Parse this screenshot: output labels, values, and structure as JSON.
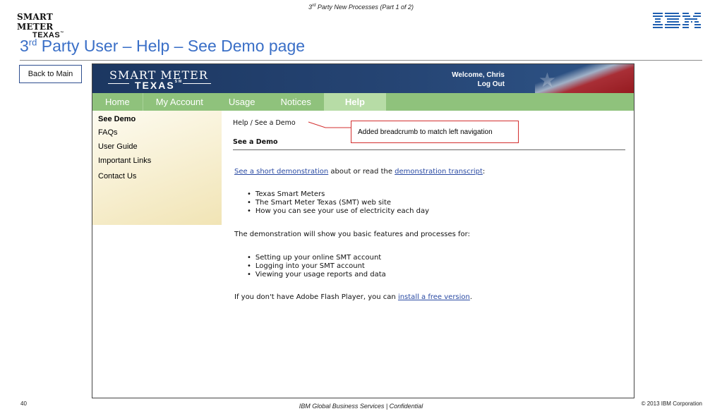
{
  "slide": {
    "header_note_sup": "rd",
    "header_note_rest": " Party New Processes (Part 1 of 2)",
    "header_note_pre": "3",
    "title_pre": "3",
    "title_sup": "rd",
    "title_rest": " Party User – Help – See Demo page",
    "logo_line1": "SMART METER",
    "logo_line2": "TEXAS",
    "logo_tm": "™",
    "ibm": "IBM",
    "back_button": "Back to Main",
    "page_number": "40",
    "footer_center": "IBM Global Business Services |  Confidential",
    "footer_right": "© 2013 IBM Corporation"
  },
  "site": {
    "logo_line1": "SMART METER",
    "logo_line2": "TEXAS",
    "logo_tm": "SM",
    "welcome": "Welcome, Chris",
    "logout": "Log Out",
    "nav": [
      "Home",
      "My Account",
      "Usage",
      "Notices",
      "Help"
    ],
    "active_nav": "Help",
    "left_nav": [
      "See Demo",
      "FAQs",
      "User Guide",
      "Important Links",
      "Contact Us"
    ],
    "breadcrumb": "Help / See a Demo",
    "section_title": "See a Demo",
    "intro_link1": "See a short demonstration",
    "intro_mid": " about or read the ",
    "intro_link2": "demonstration transcript",
    "intro_end": ":",
    "bullets1": [
      "Texas Smart Meters",
      "The Smart Meter Texas (SMT) web site",
      "How you can see your use of electricity each day"
    ],
    "para2": "The demonstration will show you basic features and processes for:",
    "bullets2": [
      "Setting up your online SMT account",
      "Logging into your SMT account",
      "Viewing your usage reports and data"
    ],
    "flash_pre": "If you don't have Adobe Flash Player, you can ",
    "flash_link": "install a free version",
    "flash_end": "."
  },
  "annotation": {
    "text": "Added breadcrumb to match left navigation",
    "color": "#d32f2f"
  },
  "colors": {
    "title_blue": "#3a6fc7",
    "banner_navy": "#1c3761",
    "nav_green": "#8fc27c",
    "link_blue": "#2a4aa3"
  }
}
